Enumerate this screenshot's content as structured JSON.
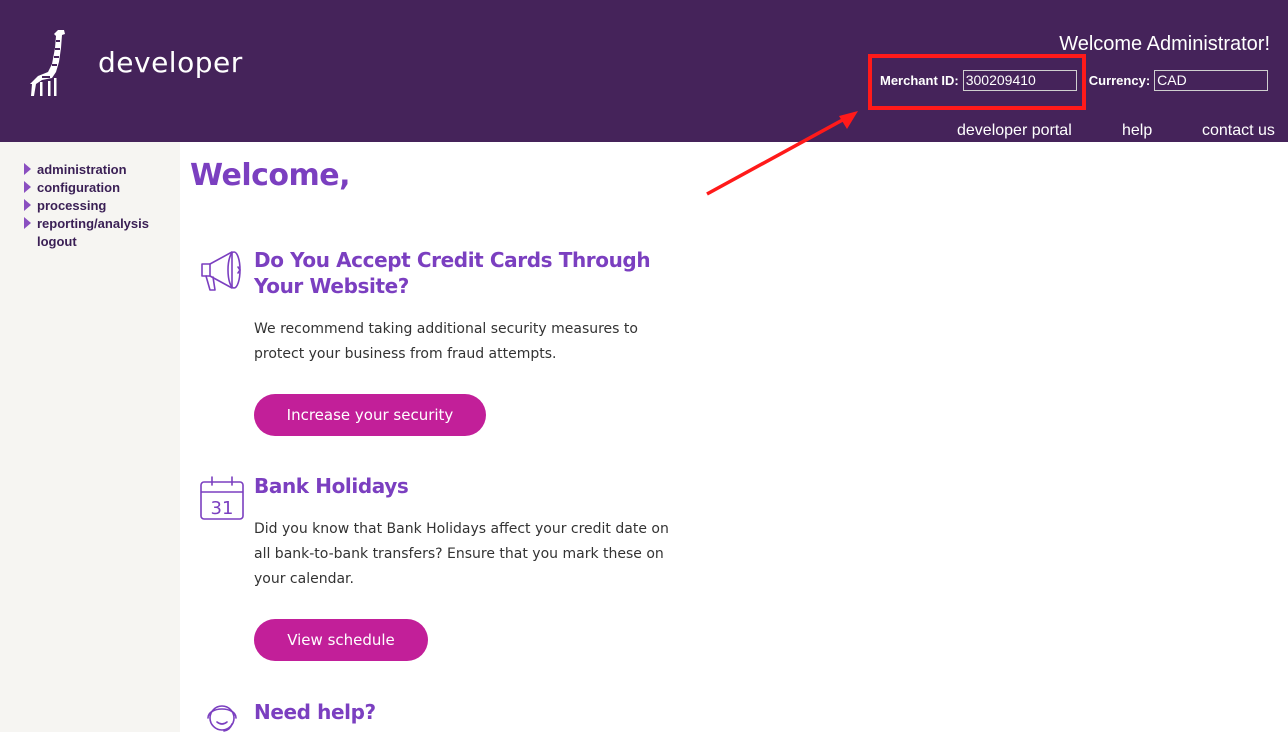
{
  "header": {
    "logo_text": "developer",
    "welcome": "Welcome Administrator!",
    "merchant_label": "Merchant ID:",
    "merchant_id": "300209410",
    "currency_label": "Currency:",
    "currency": "CAD",
    "nav": [
      "developer portal",
      "help",
      "contact us"
    ]
  },
  "sidebar": {
    "items": [
      {
        "label": "administration",
        "arrow": true
      },
      {
        "label": "configuration",
        "arrow": true
      },
      {
        "label": "processing",
        "arrow": true
      },
      {
        "label": "reporting/analysis",
        "arrow": true
      },
      {
        "label": "logout",
        "arrow": false
      }
    ]
  },
  "main": {
    "title": "Welcome,",
    "cards": [
      {
        "icon": "megaphone-icon",
        "heading": "Do You Accept Credit Cards Through Your Website?",
        "text": "We recommend taking additional security measures to protect your business from fraud attempts.",
        "button": "Increase your security"
      },
      {
        "icon": "calendar-icon",
        "calendar_day": "31",
        "heading": "Bank Holidays",
        "text": "Did you know that Bank Holidays affect your credit date on all bank-to-bank transfers? Ensure that you mark these on your calendar.",
        "button": "View schedule"
      },
      {
        "icon": "support-agent-icon",
        "heading": "Need help?"
      }
    ]
  },
  "colors": {
    "header_bg": "#45235a",
    "accent_purple": "#7b3fc0",
    "button_magenta": "#c21f99",
    "annotation_red": "#ff1a1a",
    "sidebar_bg": "#f6f5f2"
  }
}
